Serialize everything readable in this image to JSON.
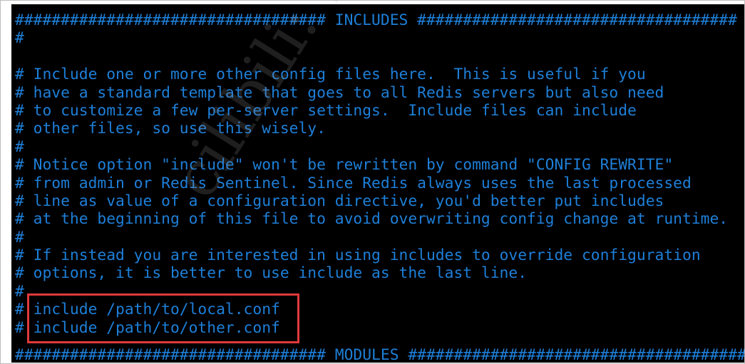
{
  "terminal": {
    "lines": [
      "################################## INCLUDES ###################################",
      "#",
      "",
      "# Include one or more other config files here.  This is useful if you",
      "# have a standard template that goes to all Redis servers but also need",
      "# to customize a few per-server settings.  Include files can include",
      "# other files, so use this wisely.",
      "#",
      "# Notice option \"include\" won't be rewritten by command \"CONFIG REWRITE\"",
      "# from admin or Redis Sentinel. Since Redis always uses the last processed",
      "# line as value of a configuration directive, you'd better put includes",
      "# at the beginning of this file to avoid overwriting config change at runtime.",
      "#",
      "# If instead you are interested in using includes to override configuration",
      "# options, it is better to use include as the last line.",
      "#",
      "# include /path/to/local.conf",
      "# include /path/to/other.conf"
    ],
    "cut_line": "################################## MODULES #####################################",
    "colors": {
      "background": "#000000",
      "text": "#1e7fd8",
      "highlight_box": "#e0393b"
    }
  },
  "watermark": "cilibili: 狂神说Java"
}
